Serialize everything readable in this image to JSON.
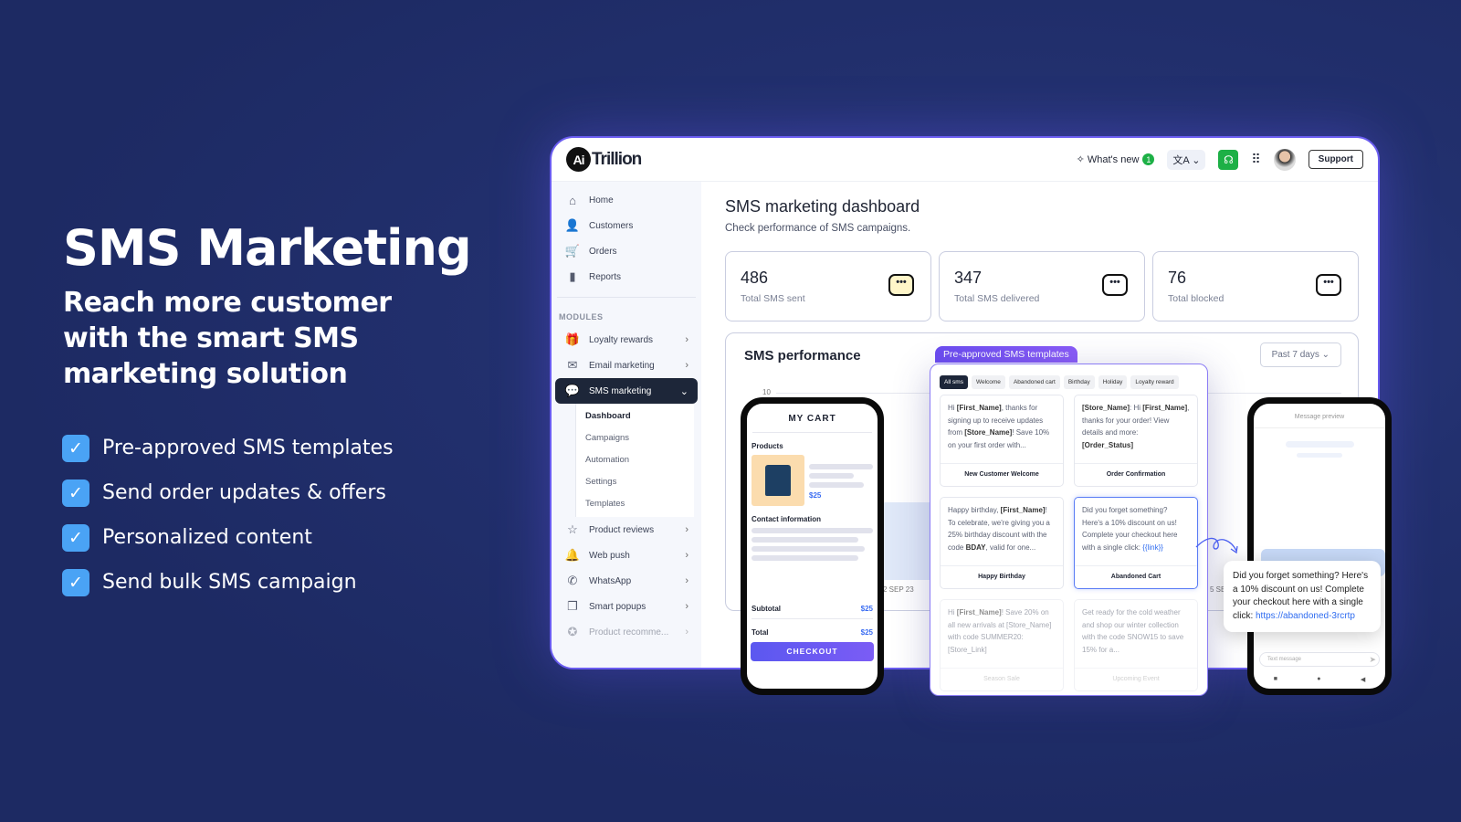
{
  "hero": {
    "title": "SMS Marketing",
    "subtitle": "Reach more customer with the smart SMS marketing solution",
    "features": [
      "Pre-approved SMS templates",
      "Send order updates & offers",
      "Personalized content",
      "Send bulk SMS campaign"
    ]
  },
  "app": {
    "logo_mark": "Ai",
    "logo_text": "Trillion",
    "whats_new": "What's new",
    "whats_new_count": "1",
    "support": "Support"
  },
  "sidebar": {
    "items": [
      {
        "label": "Home",
        "icon": "⌂"
      },
      {
        "label": "Customers",
        "icon": "👤"
      },
      {
        "label": "Orders",
        "icon": "🛒"
      },
      {
        "label": "Reports",
        "icon": "▮"
      }
    ],
    "modules_label": "MODULES",
    "modules": [
      {
        "label": "Loyalty rewards",
        "icon": "🎁"
      },
      {
        "label": "Email marketing",
        "icon": "✉"
      },
      {
        "label": "SMS marketing",
        "icon": "💬"
      },
      {
        "label": "Product reviews",
        "icon": "☆"
      },
      {
        "label": "Web push",
        "icon": "🔔"
      },
      {
        "label": "WhatsApp",
        "icon": "✆"
      },
      {
        "label": "Smart popups",
        "icon": "❐"
      },
      {
        "label": "Product recomme...",
        "icon": "✪"
      }
    ],
    "sms_sub": [
      "Dashboard",
      "Campaigns",
      "Automation",
      "Settings",
      "Templates"
    ]
  },
  "dashboard": {
    "title": "SMS marketing dashboard",
    "subtitle": "Check performance of SMS campaigns.",
    "stats": [
      {
        "value": "486",
        "label": "Total SMS sent"
      },
      {
        "value": "347",
        "label": "Total SMS delivered"
      },
      {
        "value": "76",
        "label": "Total blocked"
      }
    ],
    "performance_title": "SMS performance",
    "period": "Past 7 days",
    "y_tick": "10",
    "x_ticks": [
      "2 SEP 23",
      "5 SEP"
    ]
  },
  "cart": {
    "title": "MY CART",
    "products": "Products",
    "price": "$25",
    "contact": "Contact information",
    "subtotal_label": "Subtotal",
    "subtotal": "$25",
    "total_label": "Total",
    "total": "$25",
    "checkout": "CHECKOUT"
  },
  "templates": {
    "tab": "Pre-approved SMS templates",
    "chips": [
      "All sms",
      "Welcome",
      "Abandoned cart",
      "Birthday",
      "Holiday",
      "Loyalty reward"
    ],
    "cards": [
      {
        "name": "New Customer Welcome"
      },
      {
        "name": "Order Confirmation"
      },
      {
        "name": "Happy Birthday"
      },
      {
        "name": "Abandoned Cart"
      },
      {
        "name": "Season Sale"
      },
      {
        "name": "Upcoming Event"
      }
    ]
  },
  "preview": {
    "title": "Message preview",
    "message": "Did you forget something? Here's a 10% discount on us! Complete your checkout here with a single click: ",
    "link": "https://abandoned-3rcrtp",
    "input_placeholder": "Text message"
  }
}
